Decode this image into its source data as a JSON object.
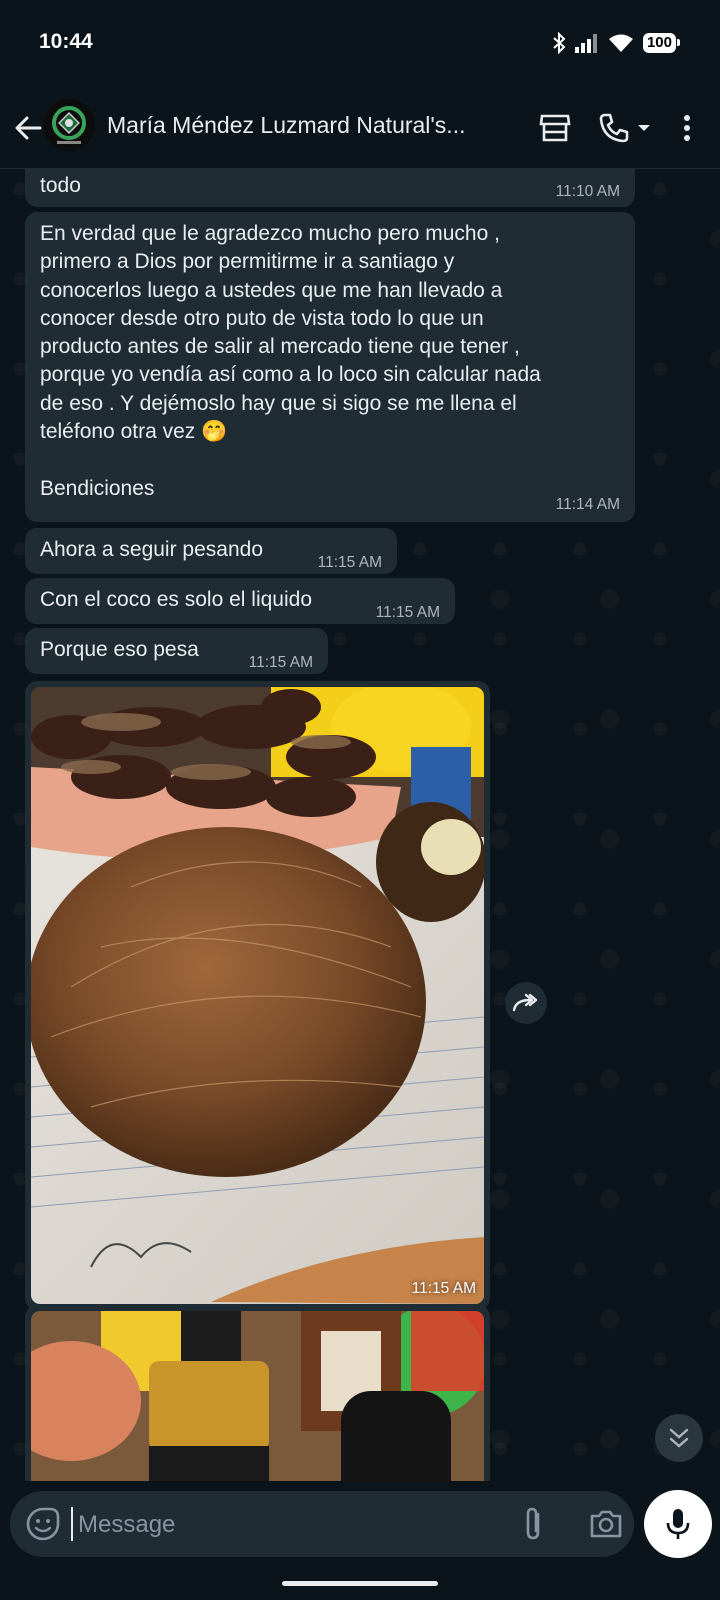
{
  "status": {
    "time": "10:44",
    "battery": "100"
  },
  "header": {
    "title": "María Méndez Luzmard Natural's..."
  },
  "messages": [
    {
      "text": "todo",
      "time": "11:10 AM"
    },
    {
      "text": "En verdad que le agradezco mucho pero mucho ,\nprimero a Dios por permitirme ir a santiago y\nconocerlos luego a ustedes que me han llevado a\nconocer desde otro puto de vista todo lo que un\nproducto antes de salir al mercado tiene que tener ,\nporque yo vendía así como a lo loco sin calcular nada\nde eso . Y dejémoslo hay que si sigo se me llena el\nteléfono otra vez 🤭\n\nBendiciones",
      "time": "11:14 AM"
    },
    {
      "text": "Ahora a seguir pesando",
      "time": "11:15 AM"
    },
    {
      "text": "Con el coco es solo el liquido",
      "time": "11:15 AM"
    },
    {
      "text": "Porque eso pesa",
      "time": "11:15 AM"
    }
  ],
  "image_message": {
    "time": "11:15 AM"
  },
  "composer": {
    "placeholder": "Message"
  },
  "colors": {
    "bubble": "#1f2c34",
    "background": "#0b141a",
    "timestamp": "#aeb6bb"
  }
}
